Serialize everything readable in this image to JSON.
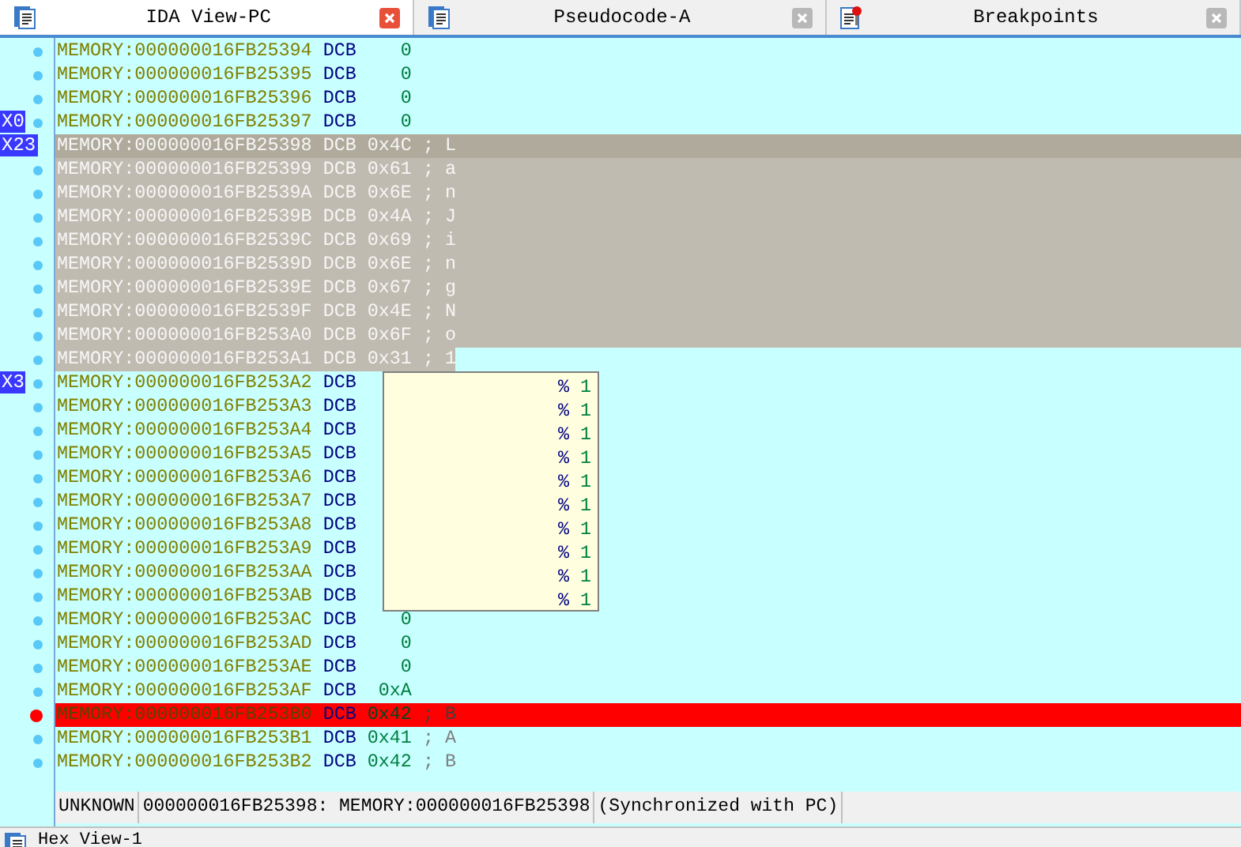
{
  "tabs": [
    {
      "label": "IDA View-PC",
      "selected": true
    },
    {
      "label": "Pseudocode-A",
      "selected": false
    },
    {
      "label": "Breakpoints",
      "selected": false
    }
  ],
  "listing": [
    {
      "address": "MEMORY:000000016FB25394",
      "op": "DCB",
      "value": "0",
      "kind": "plain"
    },
    {
      "address": "MEMORY:000000016FB25395",
      "op": "DCB",
      "value": "0",
      "kind": "plain"
    },
    {
      "address": "MEMORY:000000016FB25396",
      "op": "DCB",
      "value": "0",
      "kind": "plain"
    },
    {
      "address": "MEMORY:000000016FB25397",
      "op": "DCB",
      "value": "0",
      "kind": "plain",
      "register": "X0"
    },
    {
      "address": "MEMORY:000000016FB25398",
      "op": "DCB",
      "value": "0x4C",
      "comment": "; L",
      "kind": "cursor",
      "register": "X23"
    },
    {
      "address": "MEMORY:000000016FB25399",
      "op": "DCB",
      "value": "0x61",
      "comment": "; a",
      "kind": "selected"
    },
    {
      "address": "MEMORY:000000016FB2539A",
      "op": "DCB",
      "value": "0x6E",
      "comment": "; n",
      "kind": "selected"
    },
    {
      "address": "MEMORY:000000016FB2539B",
      "op": "DCB",
      "value": "0x4A",
      "comment": "; J",
      "kind": "selected"
    },
    {
      "address": "MEMORY:000000016FB2539C",
      "op": "DCB",
      "value": "0x69",
      "comment": "; i",
      "kind": "selected"
    },
    {
      "address": "MEMORY:000000016FB2539D",
      "op": "DCB",
      "value": "0x6E",
      "comment": "; n",
      "kind": "selected"
    },
    {
      "address": "MEMORY:000000016FB2539E",
      "op": "DCB",
      "value": "0x67",
      "comment": "; g",
      "kind": "selected"
    },
    {
      "address": "MEMORY:000000016FB2539F",
      "op": "DCB",
      "value": "0x4E",
      "comment": "; N",
      "kind": "selected"
    },
    {
      "address": "MEMORY:000000016FB253A0",
      "op": "DCB",
      "value": "0x6F",
      "comment": "; o",
      "kind": "selected"
    },
    {
      "address": "MEMORY:000000016FB253A1",
      "op": "DCB",
      "value": "0x31",
      "comment": "; 1",
      "kind": "partial"
    },
    {
      "address": "MEMORY:000000016FB253A2",
      "op": "DCB",
      "kind": "plain",
      "register": "X3"
    },
    {
      "address": "MEMORY:000000016FB253A3",
      "op": "DCB",
      "kind": "plain"
    },
    {
      "address": "MEMORY:000000016FB253A4",
      "op": "DCB",
      "kind": "plain"
    },
    {
      "address": "MEMORY:000000016FB253A5",
      "op": "DCB",
      "kind": "plain"
    },
    {
      "address": "MEMORY:000000016FB253A6",
      "op": "DCB",
      "kind": "plain"
    },
    {
      "address": "MEMORY:000000016FB253A7",
      "op": "DCB",
      "kind": "plain"
    },
    {
      "address": "MEMORY:000000016FB253A8",
      "op": "DCB",
      "kind": "plain"
    },
    {
      "address": "MEMORY:000000016FB253A9",
      "op": "DCB",
      "kind": "plain"
    },
    {
      "address": "MEMORY:000000016FB253AA",
      "op": "DCB",
      "kind": "plain"
    },
    {
      "address": "MEMORY:000000016FB253AB",
      "op": "DCB",
      "kind": "plain"
    },
    {
      "address": "MEMORY:000000016FB253AC",
      "op": "DCB",
      "value": "0",
      "kind": "plain"
    },
    {
      "address": "MEMORY:000000016FB253AD",
      "op": "DCB",
      "value": "0",
      "kind": "plain"
    },
    {
      "address": "MEMORY:000000016FB253AE",
      "op": "DCB",
      "value": "0",
      "kind": "plain"
    },
    {
      "address": "MEMORY:000000016FB253AF",
      "op": "DCB",
      "value": "0xA",
      "kind": "plain"
    },
    {
      "address": "MEMORY:000000016FB253B0",
      "op": "DCB",
      "value": "0x42",
      "comment": "; B",
      "kind": "breakpoint"
    },
    {
      "address": "MEMORY:000000016FB253B1",
      "op": "DCB",
      "value": "0x41",
      "comment": "; A",
      "kind": "plain"
    },
    {
      "address": "MEMORY:000000016FB253B2",
      "op": "DCB",
      "value": "0x42",
      "comment": "; B",
      "kind": "plain"
    }
  ],
  "hint_popup": {
    "lines": [
      {
        "sign": "%",
        "value": "1"
      },
      {
        "sign": "%",
        "value": "1"
      },
      {
        "sign": "%",
        "value": "1"
      },
      {
        "sign": "%",
        "value": "1"
      },
      {
        "sign": "%",
        "value": "1"
      },
      {
        "sign": "%",
        "value": "1"
      },
      {
        "sign": "%",
        "value": "1"
      },
      {
        "sign": "%",
        "value": "1"
      },
      {
        "sign": "%",
        "value": "1"
      },
      {
        "sign": "%",
        "value": "1"
      }
    ]
  },
  "status_bar": [
    "UNKNOWN",
    "000000016FB25398: MEMORY:000000016FB25398",
    "(Synchronized with PC)"
  ],
  "bottom_tab": {
    "label": "Hex View-1"
  }
}
